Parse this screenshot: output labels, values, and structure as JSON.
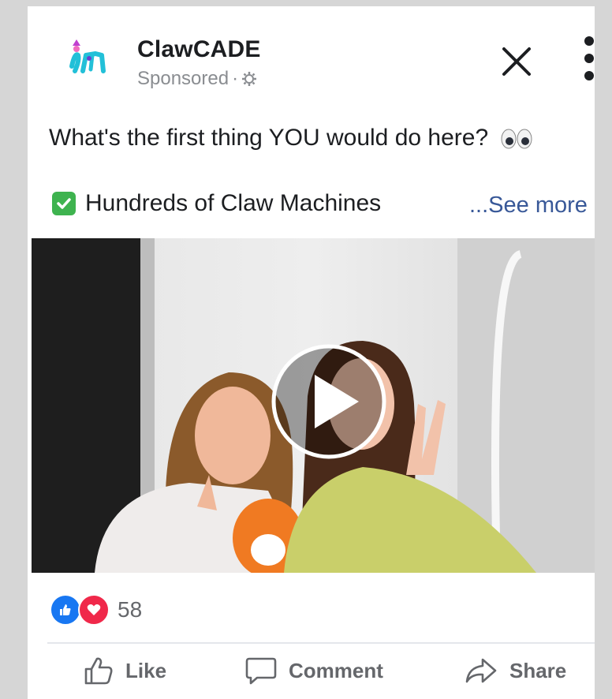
{
  "post": {
    "page_name": "ClawCADE",
    "sponsored_label": "Sponsored",
    "meta_separator": " · ",
    "caption": "What's the first thing YOU would do here?",
    "feature_text": "Hundreds of Claw Machines",
    "see_more": "...See more"
  },
  "icons": {
    "close": "close-icon",
    "more": "more-options-icon",
    "globe": "gear-icon",
    "eyes": "eyes-emoji-icon",
    "check": "check-mark-icon",
    "play": "play-icon",
    "like_reaction": "like-reaction-icon",
    "love_reaction": "love-reaction-icon"
  },
  "reactions": {
    "count": "58"
  },
  "actions": {
    "like": "Like",
    "comment": "Comment",
    "share": "Share"
  },
  "colors": {
    "like_blue": "#1877f2",
    "love_red": "#f0284a",
    "check_green": "#3eb34f",
    "link_blue": "#385898"
  }
}
